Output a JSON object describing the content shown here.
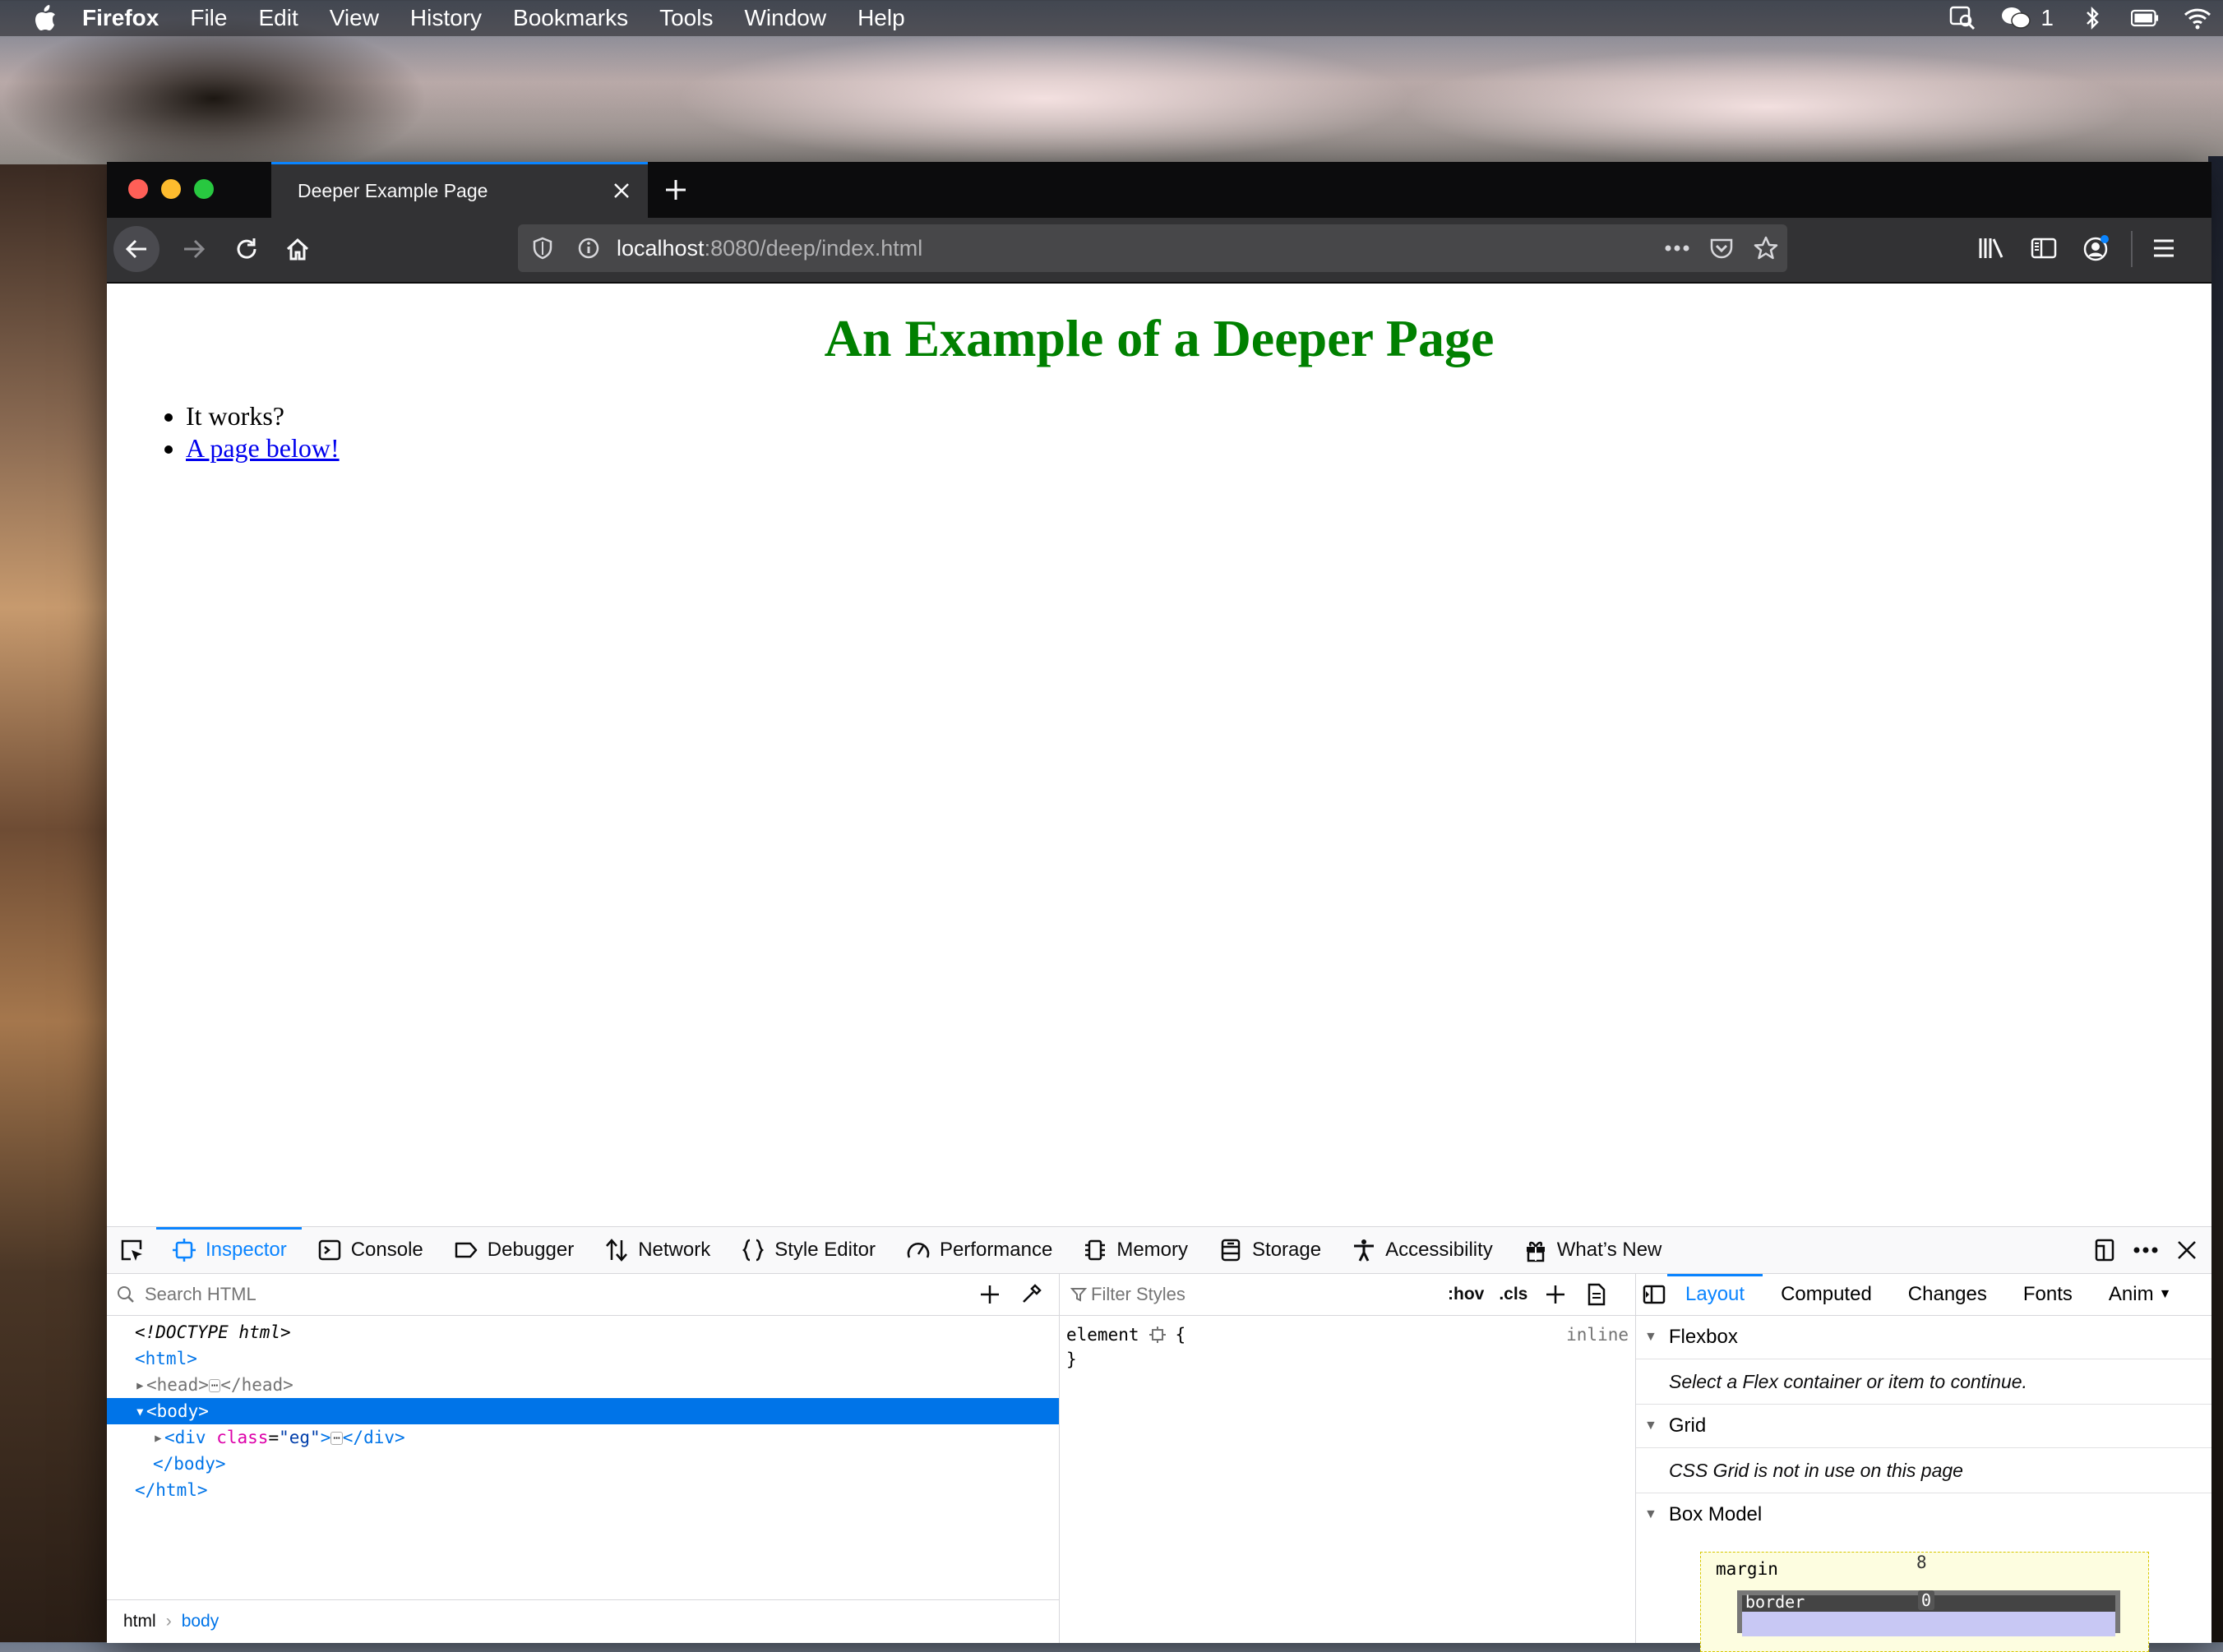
{
  "menubar": {
    "app_name": "Firefox",
    "items": [
      "File",
      "Edit",
      "View",
      "History",
      "Bookmarks",
      "Tools",
      "Window",
      "Help"
    ],
    "wechat_count": "1"
  },
  "browser": {
    "tab_title": "Deeper Example Page",
    "url_host": "localhost",
    "url_rest": ":8080/deep/index.html"
  },
  "page": {
    "heading": "An Example of a Deeper Page",
    "list_item_1": "It works?",
    "list_item_2_link": "A page below!",
    "heading_color": "#008000",
    "link_color": "#0000ee"
  },
  "devtools": {
    "tabs": [
      "Inspector",
      "Console",
      "Debugger",
      "Network",
      "Style Editor",
      "Performance",
      "Memory",
      "Storage",
      "Accessibility",
      "What’s New"
    ],
    "search_placeholder": "Search HTML",
    "filter_placeholder": "Filter Styles",
    "hov": ":hov",
    "cls": ".cls",
    "tree": {
      "doctype": "<!DOCTYPE html>",
      "html_open": "<html>",
      "head_open": "<head>",
      "head_close": "</head>",
      "body_open": "<body>",
      "div_open_tag": "<div",
      "div_attr_name": "class",
      "div_attr_value": "\"eg\"",
      "div_close": "</div>",
      "body_close": "</body>",
      "html_close": "</html>"
    },
    "breadcrumbs": [
      "html",
      "body"
    ],
    "rule_selector": "element",
    "rule_open": "{",
    "rule_close": "}",
    "rule_source": "inline",
    "layout_tabs": [
      "Layout",
      "Computed",
      "Changes",
      "Fonts",
      "Anim"
    ],
    "flexbox_title": "Flexbox",
    "flexbox_msg": "Select a Flex container or item to continue.",
    "grid_title": "Grid",
    "grid_msg": "CSS Grid is not in use on this page",
    "boxmodel_title": "Box Model",
    "bm_margin_label": "margin",
    "bm_margin_top": "8",
    "bm_border_label": "border",
    "bm_border_top": "0"
  }
}
